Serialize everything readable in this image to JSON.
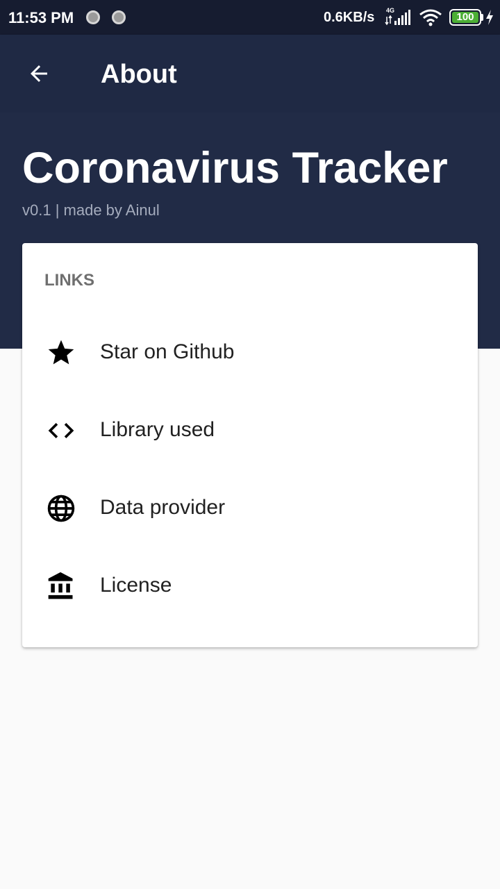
{
  "status_bar": {
    "time": "11:53 PM",
    "net_speed": "0.6KB/s",
    "network_type": "4G",
    "battery": "100",
    "icons": [
      "notification-dot-icon",
      "notification-dot-icon",
      "signal-icon",
      "wifi-icon",
      "battery-icon",
      "charging-bolt-icon"
    ]
  },
  "app_bar": {
    "back_icon": "arrow-back-icon",
    "title": "About"
  },
  "header": {
    "app_name": "Coronavirus Tracker",
    "subtitle": "v0.1 | made by Ainul"
  },
  "links_card": {
    "heading": "LINKS",
    "items": [
      {
        "icon": "star-icon",
        "label": "Star on Github"
      },
      {
        "icon": "code-icon",
        "label": "Library used"
      },
      {
        "icon": "globe-icon",
        "label": "Data provider"
      },
      {
        "icon": "bank-icon",
        "label": "License"
      }
    ]
  },
  "colors": {
    "status_bar": "#161c30",
    "app_bar": "#1f2944",
    "header": "#212b46",
    "background": "#fafafa",
    "card": "#ffffff",
    "battery": "#4caf35"
  }
}
